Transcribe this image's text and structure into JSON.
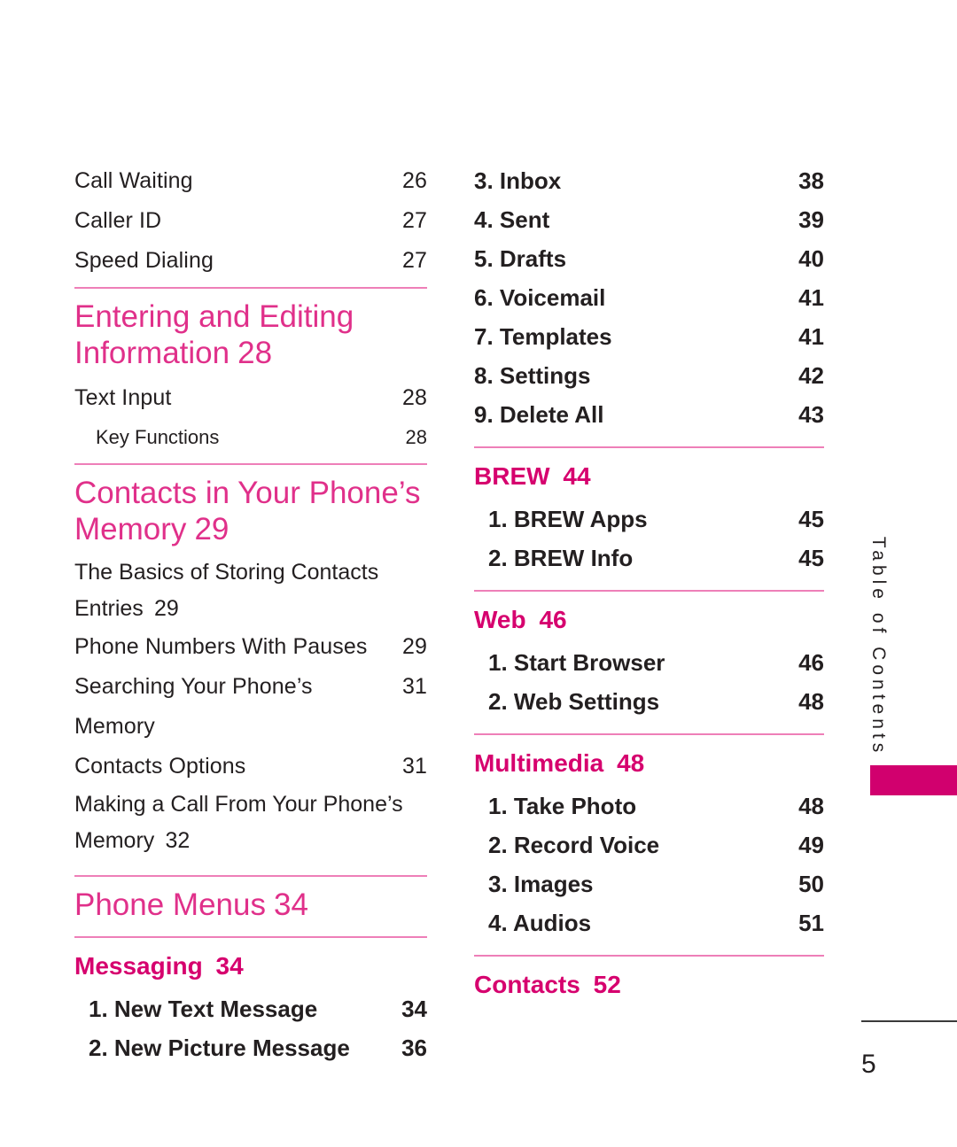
{
  "document": {
    "page_number": "5",
    "side_tab_label": "Table of Contents"
  },
  "colors": {
    "chapter_magenta": "#E0308A",
    "subchapter_magenta": "#D6006E",
    "rule_pink": "#EE7FB8",
    "tab_block": "#D1006E",
    "body_text": "#231F20"
  },
  "left_column": {
    "entries": [
      {
        "label": "Call Waiting",
        "page": "26"
      },
      {
        "label": "Caller ID",
        "page": "27"
      },
      {
        "label": "Speed Dialing",
        "page": "27"
      }
    ],
    "chapter_entering": {
      "line1": "Entering and Editing",
      "line2": "Information",
      "page": "28"
    },
    "entering_entries": [
      {
        "label": "Text Input",
        "page": "28"
      }
    ],
    "entering_sub": [
      {
        "label": "Key Functions",
        "page": "28"
      }
    ],
    "chapter_contacts": {
      "line1": "Contacts in Your Phone’s",
      "line2": "Memory",
      "page": "29"
    },
    "contacts_entries": [
      {
        "line1": "The Basics of Storing Contacts",
        "line2": "Entries",
        "page": "29"
      },
      {
        "label": "Phone Numbers With Pauses",
        "page": "29"
      },
      {
        "label": "Searching Your Phone’s Memory",
        "page": "31"
      },
      {
        "label": "Contacts Options",
        "page": "31"
      },
      {
        "line1": "Making a Call From Your Phone’s",
        "line2": "Memory",
        "page": "32"
      }
    ],
    "chapter_phone_menus": {
      "label": "Phone Menus",
      "page": "34"
    },
    "subchapter_messaging": {
      "label": "Messaging",
      "page": "34"
    },
    "messaging_entries": [
      {
        "label": "1. New Text Message",
        "page": "34"
      },
      {
        "label": "2. New Picture Message",
        "page": "36"
      }
    ]
  },
  "right_column": {
    "messaging_continued": [
      {
        "label": "3. Inbox",
        "page": "38"
      },
      {
        "label": "4. Sent",
        "page": "39"
      },
      {
        "label": "5. Drafts",
        "page": "40"
      },
      {
        "label": "6. Voicemail",
        "page": "41"
      },
      {
        "label": "7. Templates",
        "page": "41"
      },
      {
        "label": "8. Settings",
        "page": "42"
      },
      {
        "label": "9. Delete All",
        "page": "43"
      }
    ],
    "subchapter_brew": {
      "label": "BREW",
      "page": "44"
    },
    "brew_entries": [
      {
        "label": "1. BREW Apps",
        "page": "45"
      },
      {
        "label": "2. BREW Info",
        "page": "45"
      }
    ],
    "subchapter_web": {
      "label": "Web",
      "page": "46"
    },
    "web_entries": [
      {
        "label": "1. Start Browser",
        "page": "46"
      },
      {
        "label": "2. Web Settings",
        "page": "48"
      }
    ],
    "subchapter_multimedia": {
      "label": "Multimedia",
      "page": "48"
    },
    "multimedia_entries": [
      {
        "label": "1. Take Photo",
        "page": "48"
      },
      {
        "label": "2. Record Voice",
        "page": "49"
      },
      {
        "label": "3. Images",
        "page": "50"
      },
      {
        "label": "4. Audios",
        "page": "51"
      }
    ],
    "subchapter_contacts": {
      "label": "Contacts",
      "page": "52"
    }
  }
}
